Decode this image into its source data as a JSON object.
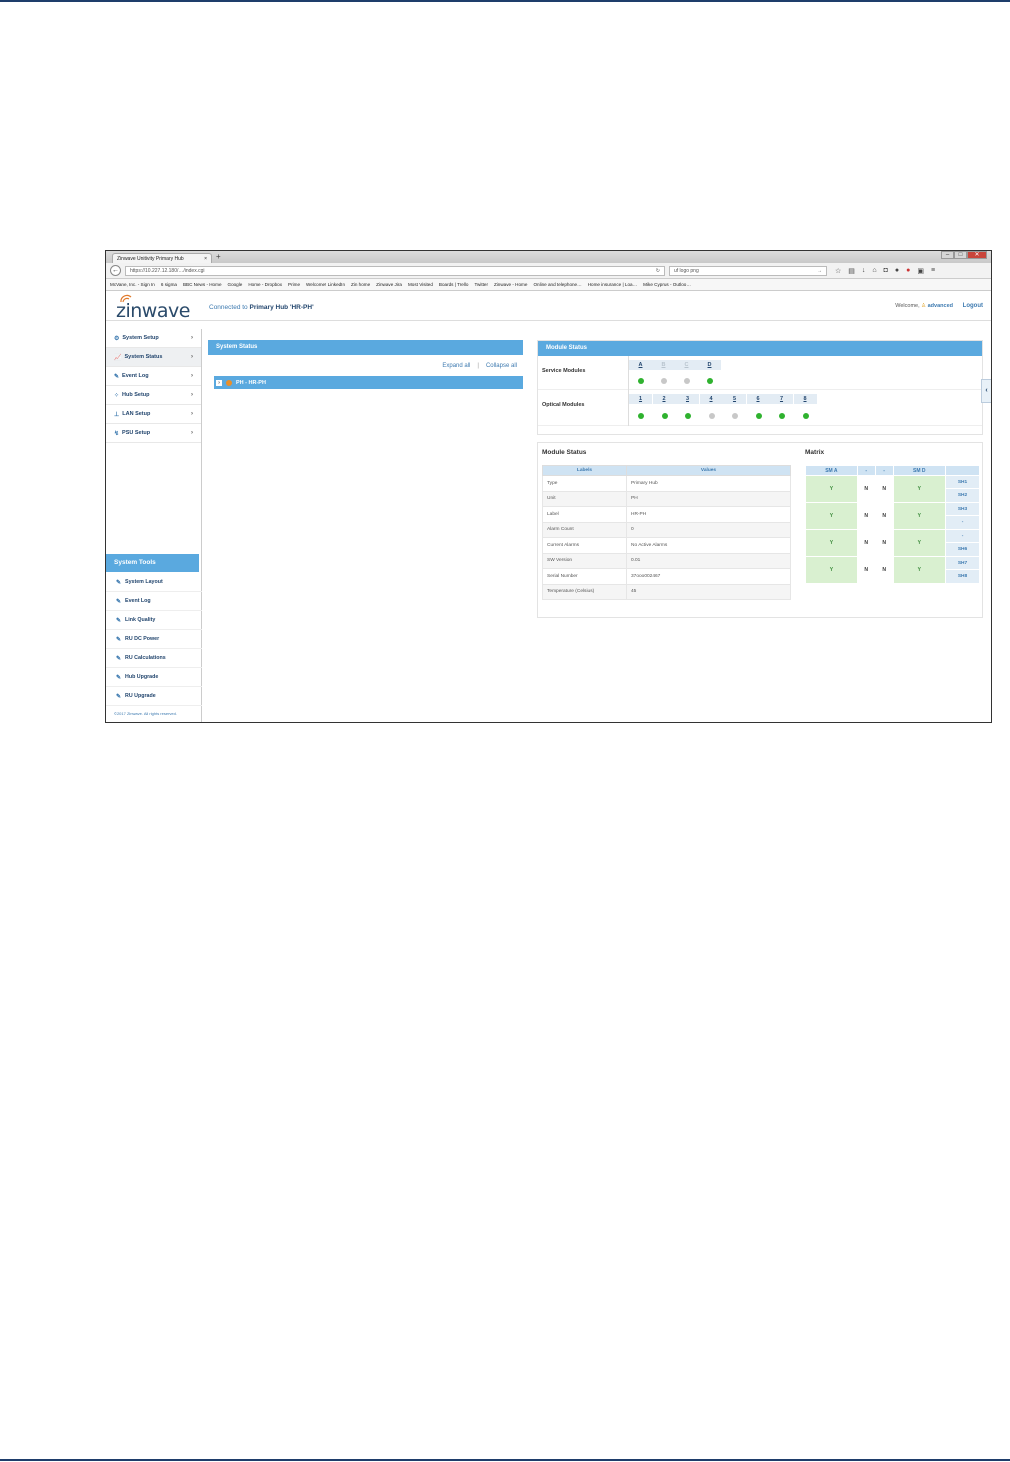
{
  "browser": {
    "tab_title": "Zinwave Unitivity Primary Hub",
    "tab_close": "×",
    "new_tab": "+",
    "url": "https://10.227.12.180/…/index.cgi",
    "search_text": "uf logo png",
    "bookmarks": [
      "McVane, Inc. - Sign In",
      "6 sigma",
      "BBC News - Home",
      "Google",
      "Home - Dropbox",
      "Prime",
      "Welcome! LinkedIn",
      "Zin home",
      "Zinwave Jira",
      "Most Visited",
      "Boards | Trello",
      "Twitter",
      "Zinwave - Home",
      "Online and telephone…",
      "Home insurance | Loa…",
      "Mike Cyprus - Outloo…"
    ]
  },
  "header": {
    "logo_text": "zinwave",
    "connected_prefix": "Connected to",
    "connected_target": "Primary Hub 'HR-PH'",
    "welcome_label": "Welcome,",
    "username": "advanced",
    "logout_label": "Logout"
  },
  "sidebar": {
    "items": [
      {
        "label": "System Setup",
        "icon": "⚙"
      },
      {
        "label": "System Status",
        "icon": "📈"
      },
      {
        "label": "Event Log",
        "icon": "✎"
      },
      {
        "label": "Hub Setup",
        "icon": "⁘"
      },
      {
        "label": "LAN Setup",
        "icon": "⊥"
      },
      {
        "label": "PSU Setup",
        "icon": "↯"
      }
    ],
    "tools_title": "System Tools",
    "tools": [
      "System Layout",
      "Event Log",
      "Link Quality",
      "RU DC Power",
      "RU Calculations",
      "Hub Upgrade",
      "RU Upgrade"
    ],
    "copyright": "©2017 Zinwave. All rights reserved."
  },
  "system_status": {
    "title": "System Status",
    "expand_all": "Expand all",
    "separator": "|",
    "collapse_all": "Collapse all",
    "tree_item": "PH - HR-PH"
  },
  "module_status": {
    "title": "Module Status",
    "service_label": "Service Modules",
    "service_slots": [
      "A",
      "B",
      "C",
      "D"
    ],
    "service_state": [
      "on",
      "off",
      "off",
      "on"
    ],
    "optical_label": "Optical Modules",
    "optical_slots": [
      "1",
      "2",
      "3",
      "4",
      "5",
      "6",
      "7",
      "8"
    ],
    "optical_state": [
      "on",
      "on",
      "on",
      "off",
      "off",
      "on",
      "on",
      "on"
    ]
  },
  "module_details": {
    "title": "Module Status",
    "col_labels": "Labels",
    "col_values": "Values",
    "rows": [
      {
        "label": "Type",
        "value": "Primary Hub"
      },
      {
        "label": "Unit",
        "value": "PH"
      },
      {
        "label": "Label",
        "value": "HR-PH"
      },
      {
        "label": "Alarm Count",
        "value": "0"
      },
      {
        "label": "Current Alarms",
        "value": "No Active Alarms"
      },
      {
        "label": "SW Version",
        "value": "0.01"
      },
      {
        "label": "Serial Number",
        "value": "37ooo002467"
      },
      {
        "label": "Temperature (Celsius)",
        "value": "45"
      }
    ]
  },
  "matrix": {
    "title": "Matrix",
    "headers": [
      "SM A",
      "-",
      "-",
      "SM D"
    ],
    "rows": [
      {
        "cells": [
          "Y",
          "N",
          "N",
          "Y"
        ],
        "sh": [
          "SH1",
          "SH2"
        ]
      },
      {
        "cells": [
          "Y",
          "N",
          "N",
          "Y"
        ],
        "sh": [
          "SH3",
          "-"
        ]
      },
      {
        "cells": [
          "Y",
          "N",
          "N",
          "Y"
        ],
        "sh": [
          "-",
          "SH6"
        ]
      },
      {
        "cells": [
          "Y",
          "N",
          "N",
          "Y"
        ],
        "sh": [
          "SH7",
          "SH8"
        ]
      }
    ]
  },
  "colors": {
    "accent": "#5aa9df",
    "ok": "#2fb22f",
    "inactive": "#c8c8c8",
    "alarm": "#e88f2a"
  }
}
